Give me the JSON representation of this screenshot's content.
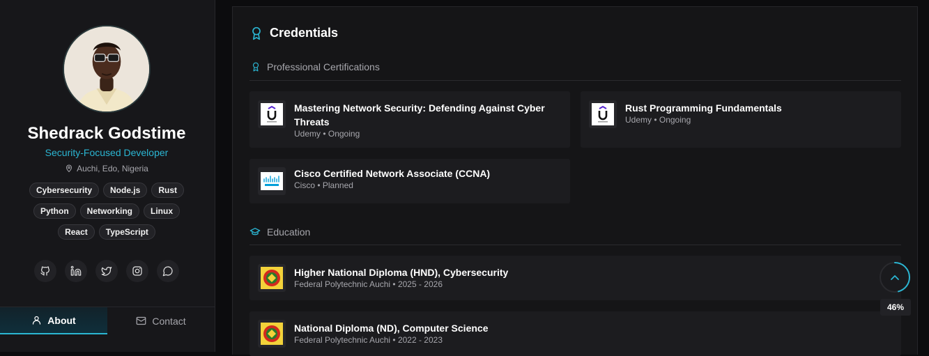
{
  "profile": {
    "name": "Shedrack Godstime",
    "role": "Security-Focused Developer",
    "location": "Auchi, Edo, Nigeria",
    "skills_row1": [
      "Cybersecurity",
      "Node.js",
      "Rust"
    ],
    "skills_row2": [
      "Python",
      "Networking",
      "Linux"
    ],
    "skills_row3": [
      "React",
      "TypeScript"
    ],
    "social": [
      "github-icon",
      "linkedin-icon",
      "twitter-icon",
      "instagram-icon",
      "chat-icon"
    ]
  },
  "tabs": [
    {
      "label": "About",
      "icon": "user-icon",
      "active": true
    },
    {
      "label": "Contact",
      "icon": "mail-icon",
      "active": false
    }
  ],
  "credentials": {
    "title": "Credentials",
    "certifications": {
      "heading": "Professional Certifications",
      "items": [
        {
          "title": "Mastering Network Security: Defending Against Cyber Threats",
          "meta": "Udemy • Ongoing",
          "logo": "udemy-logo"
        },
        {
          "title": "Rust Programming Fundamentals",
          "meta": "Udemy • Ongoing",
          "logo": "udemy-logo"
        },
        {
          "title": "Cisco Certified Network Associate (CCNA)",
          "meta": "Cisco • Planned",
          "logo": "cisco-logo"
        }
      ]
    },
    "education": {
      "heading": "Education",
      "items": [
        {
          "title": "Higher National Diploma (HND), Cybersecurity",
          "meta": "Federal Polytechnic Auchi • 2025 - 2026",
          "logo": "polytechnic-crest"
        },
        {
          "title": "National Diploma (ND), Computer Science",
          "meta": "Federal Polytechnic Auchi • 2022 - 2023",
          "logo": "polytechnic-crest"
        }
      ]
    }
  },
  "scroll_progress": {
    "percent": 46,
    "label": "46%"
  },
  "colors": {
    "accent": "#2bb6d3",
    "background": "#0c0c0e",
    "card": "#151517",
    "item": "#1c1c1f"
  }
}
